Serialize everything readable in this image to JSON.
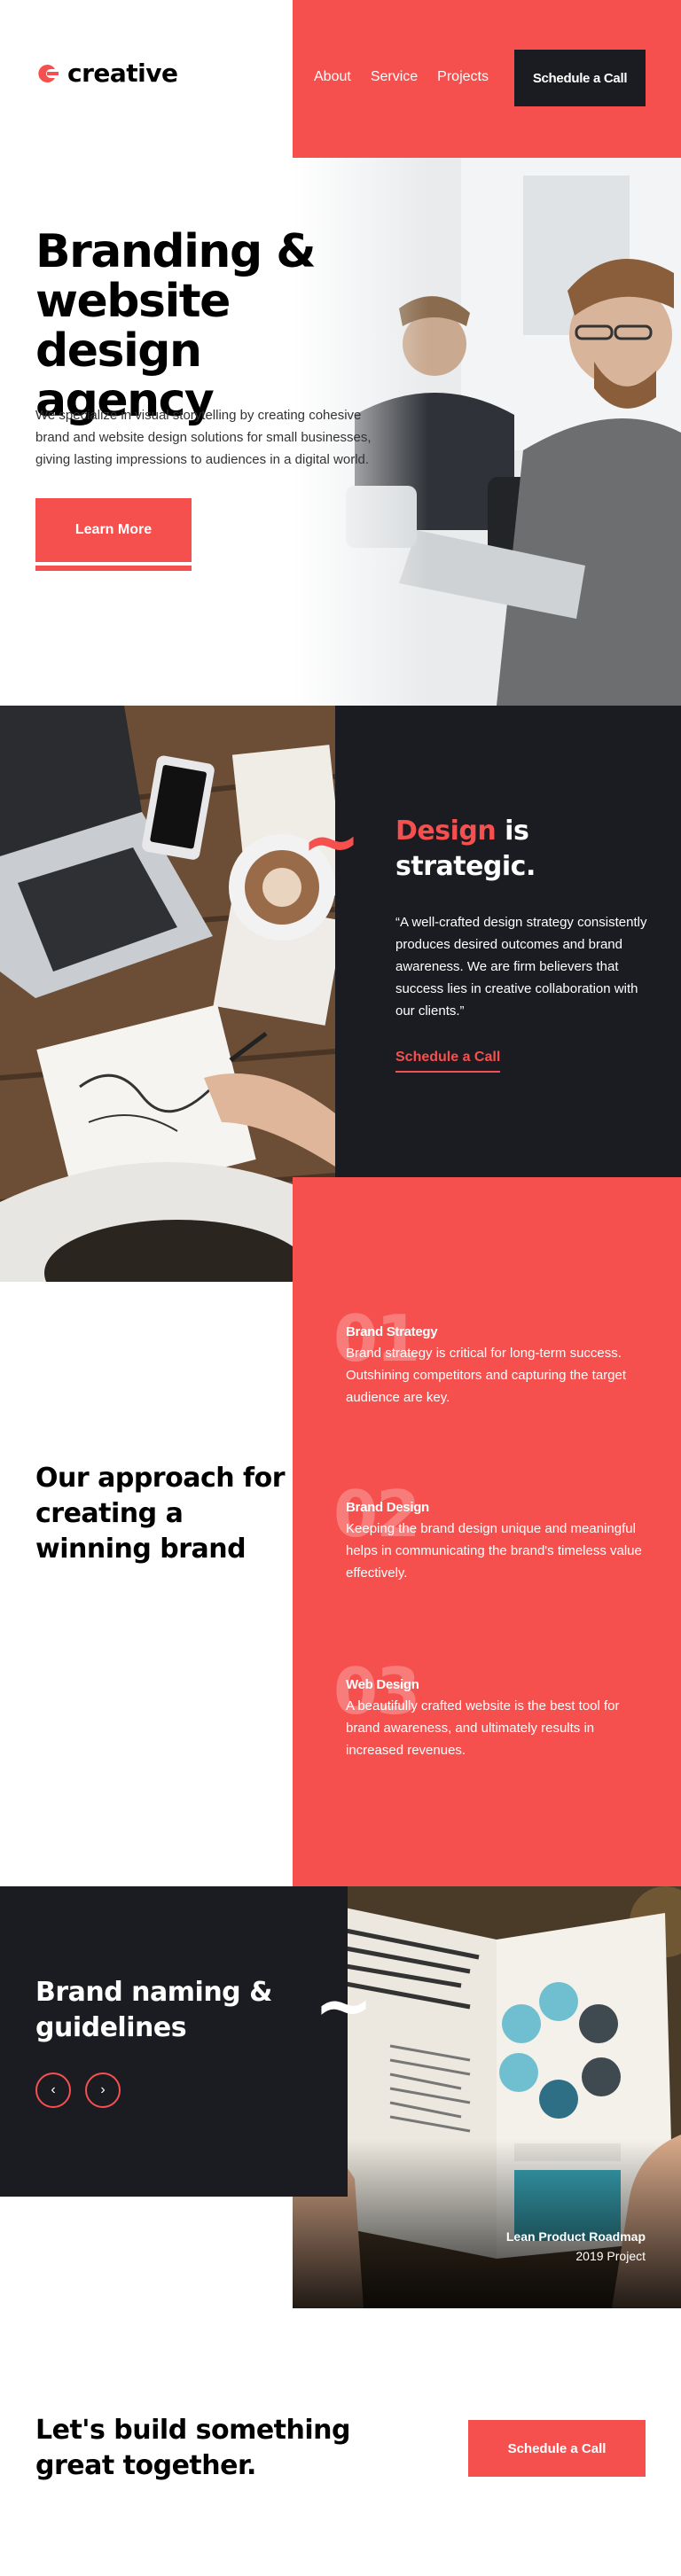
{
  "colors": {
    "accent": "#f6504e",
    "dark": "#1b1c22",
    "white": "#ffffff"
  },
  "brand": {
    "name": "creative",
    "logo_icon": "c-logo-icon"
  },
  "nav": {
    "items": [
      {
        "label": "About"
      },
      {
        "label": "Service"
      },
      {
        "label": "Projects"
      }
    ],
    "cta_label": "Schedule a Call"
  },
  "hero": {
    "title_lines": [
      "Branding &",
      "website design",
      "agency"
    ],
    "description": "We specialize in visual storytelling by creating cohesive brand and website design solutions for small businesses, giving lasting impressions to audiences in a digital world.",
    "button_label": "Learn More"
  },
  "design_section": {
    "title_accent": "Design",
    "title_rest": " is strategic.",
    "quote": "“A well-crafted design strategy consistently produces desired outcomes and brand awareness. We are firm believers that success lies in creative collaboration with our clients.”",
    "cta_label": "Schedule a Call"
  },
  "approach": {
    "title": "Our approach for creating a winning brand",
    "steps": [
      {
        "num": "01",
        "title": "Brand Strategy",
        "text": "Brand strategy is critical for long-term success. Outshining competitors and capturing the target audience are key."
      },
      {
        "num": "02",
        "title": "Brand Design",
        "text": "Keeping the brand design unique and meaningful helps in communicating the brand's timeless value effectively."
      },
      {
        "num": "03",
        "title": "Web Design",
        "text": "A beautifully crafted website is the best tool for brand awareness, and ultimately results in increased revenues."
      }
    ]
  },
  "brand_naming": {
    "title": "Brand naming & guidelines",
    "prev_icon": "chevron-left-icon",
    "next_icon": "chevron-right-icon",
    "project_title": "Lean Product Roadmap",
    "project_year": "2019 Project"
  },
  "footer_cta": {
    "title": "Let's build something great together.",
    "button_label": "Schedule a Call"
  }
}
